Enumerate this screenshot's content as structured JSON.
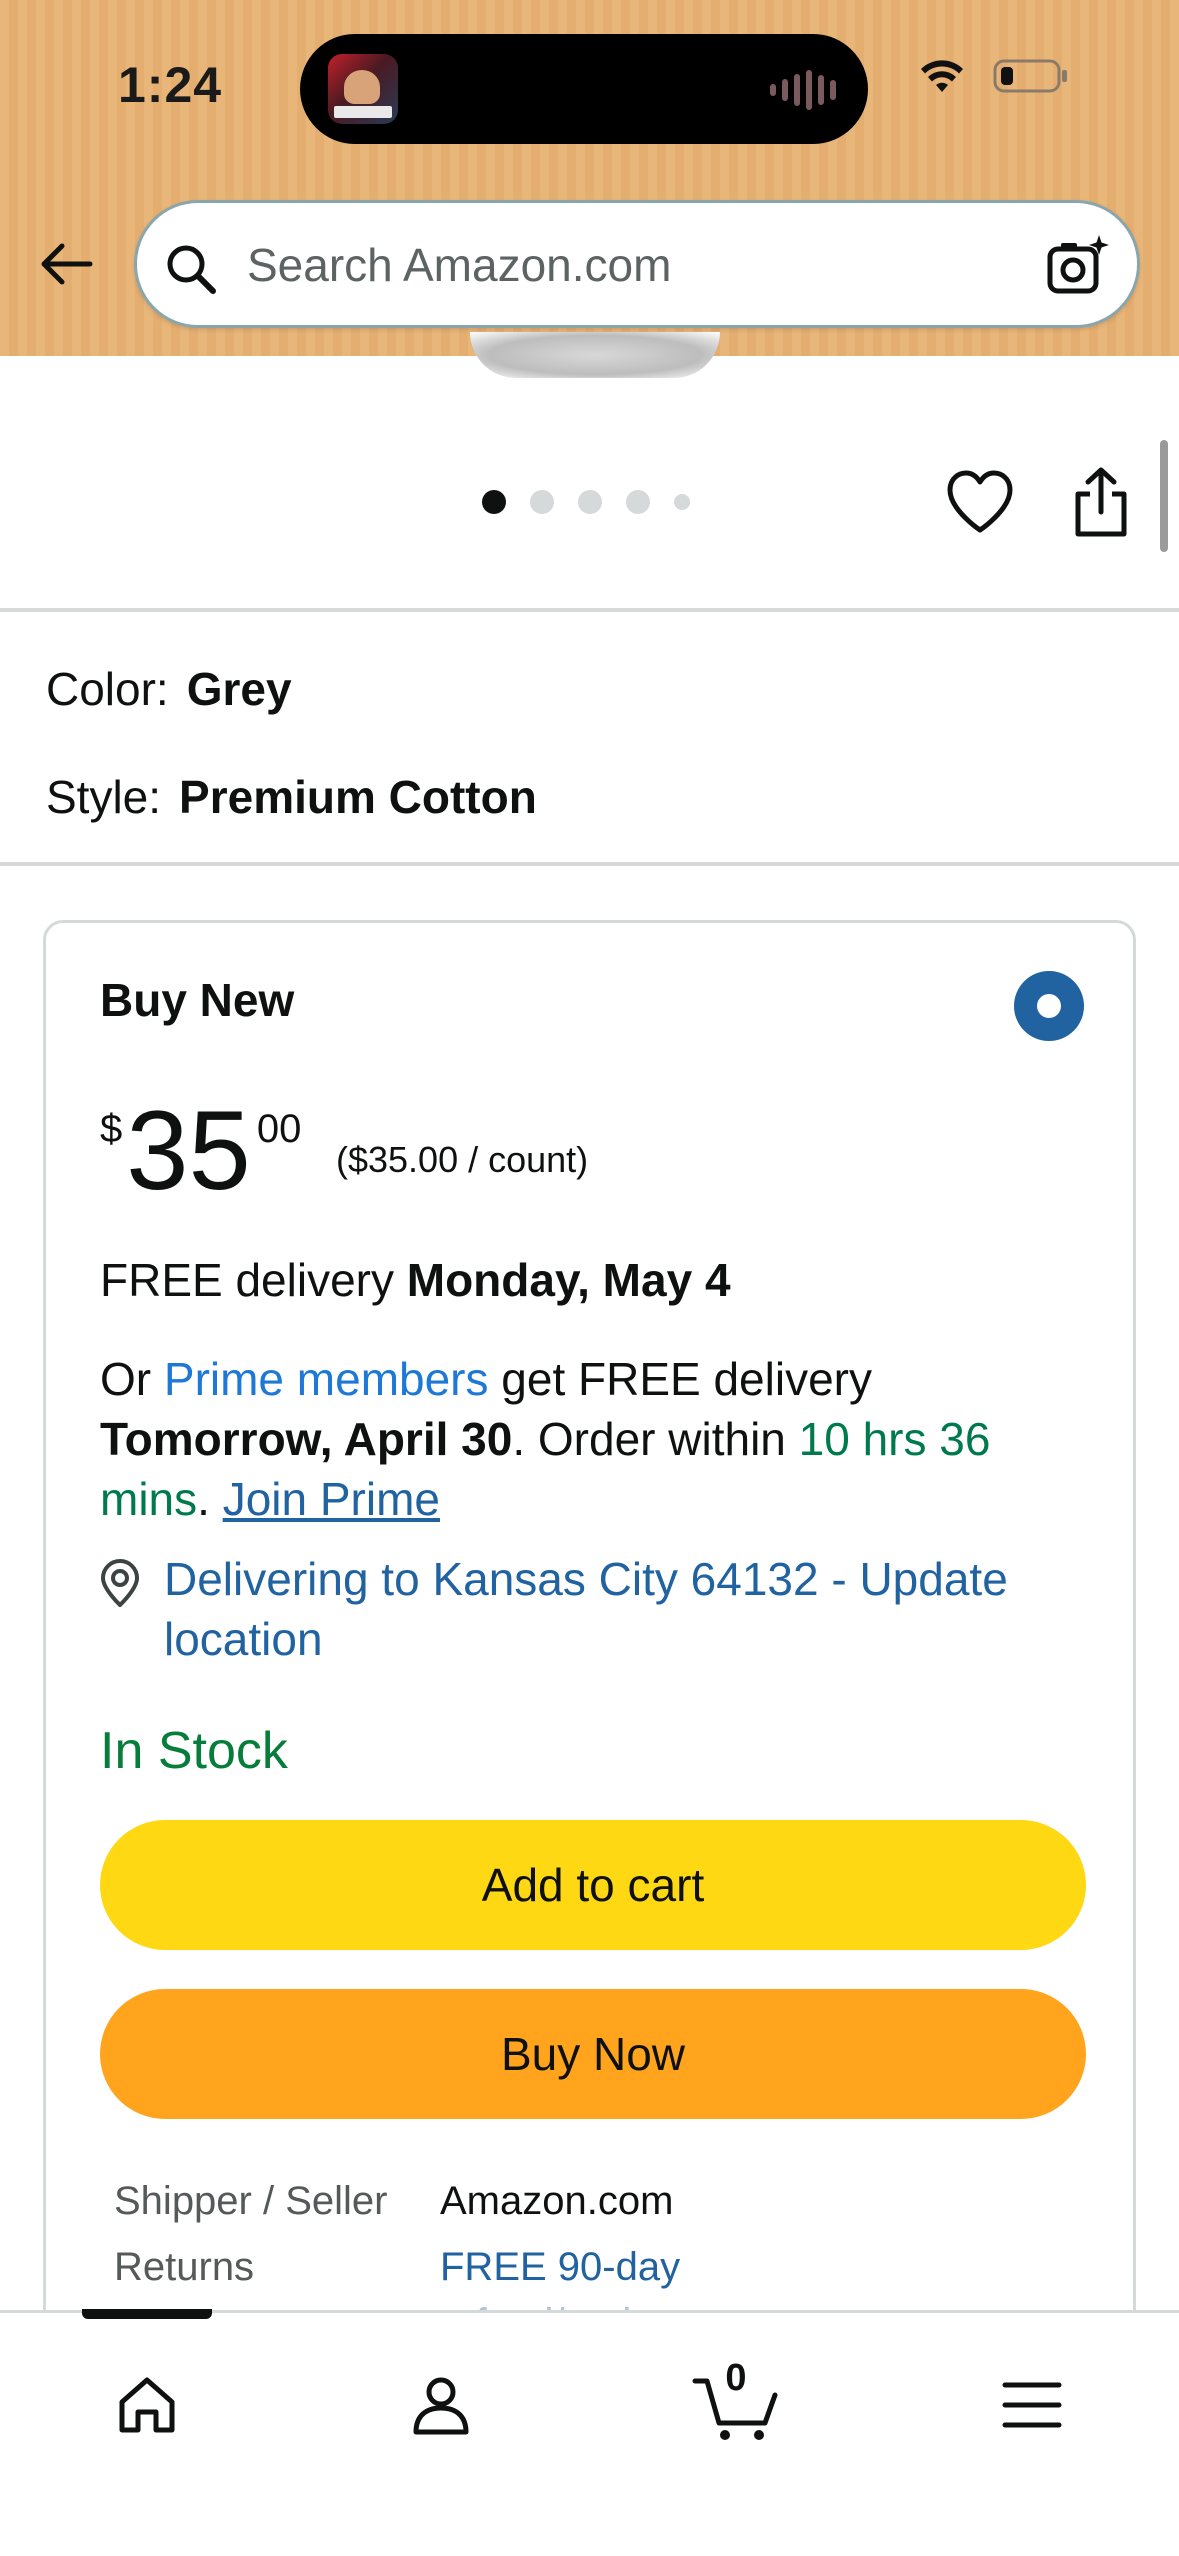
{
  "status_bar": {
    "time": "1:24"
  },
  "search": {
    "placeholder": "Search Amazon.com"
  },
  "gallery": {
    "total_images": 5,
    "active_index": 0
  },
  "variations": [
    {
      "label": "Color:",
      "value": "Grey"
    },
    {
      "label": "Style:",
      "value": "Premium Cotton"
    }
  ],
  "buy_box": {
    "title": "Buy New",
    "price": {
      "currency": "$",
      "whole": "35",
      "fraction": "00",
      "unit": "($35.00 / count)"
    },
    "delivery": {
      "prefix": "FREE delivery ",
      "date": "Monday, May 4"
    },
    "prime": {
      "prefix": "Or ",
      "members_link": "Prime members",
      "middle": " get FREE delivery ",
      "date": "Tomorrow, April 30",
      "order_within": ". Order within ",
      "countdown": "10 hrs 36 mins",
      "period": ". ",
      "join_link": "Join Prime"
    },
    "location": "Delivering to Kansas City 64132 - Update location",
    "stock": "In Stock",
    "add_to_cart": "Add to cart",
    "buy_now": "Buy Now",
    "info": [
      {
        "label": "Shipper / Seller",
        "value": "Amazon.com"
      },
      {
        "label": "Returns",
        "value": "FREE 90-day"
      }
    ],
    "returns_continuation": "refund/replacement"
  },
  "bottom_nav": {
    "cart_count": "0"
  },
  "colors": {
    "header_bg": "#e9b679",
    "link_blue": "#2162a1",
    "prime_blue": "#1e78d6",
    "countdown_green": "#007a4d",
    "stock_green": "#067d3a",
    "add_to_cart_yellow": "#ffd814",
    "buy_now_orange": "#ffa41c"
  }
}
